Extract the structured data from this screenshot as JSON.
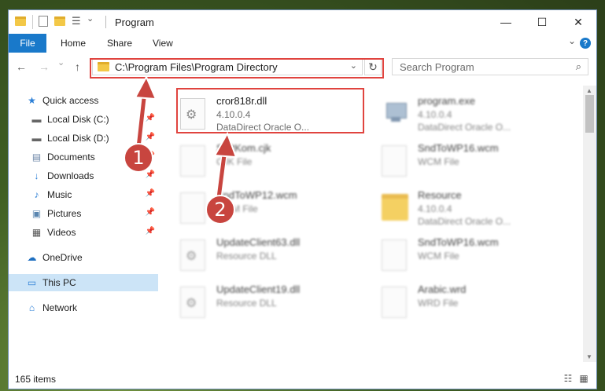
{
  "window": {
    "title": "Program"
  },
  "titlebar": {
    "minimize": "—",
    "maximize": "☐",
    "close": "✕"
  },
  "ribbon": {
    "file": "File",
    "tabs": [
      "Home",
      "Share",
      "View"
    ],
    "collapse": "⌄",
    "help": "?"
  },
  "nav": {
    "back": "←",
    "forward": "→",
    "dropdown": "⌄",
    "up": "↑"
  },
  "address": {
    "path": "C:\\Program Files\\Program Directory",
    "dropdown": "⌄",
    "refresh": "↻"
  },
  "search": {
    "placeholder": "Search Program",
    "icon": "⌕"
  },
  "sidebar": {
    "items": [
      {
        "label": "Quick access",
        "icon": "★"
      },
      {
        "label": "Local Disk (C:)",
        "icon": "▬"
      },
      {
        "label": "Local Disk (D:)",
        "icon": "▬"
      },
      {
        "label": "Documents",
        "icon": "▤"
      },
      {
        "label": "Downloads",
        "icon": "↓"
      },
      {
        "label": "Music",
        "icon": "♪"
      },
      {
        "label": "Pictures",
        "icon": "▣"
      },
      {
        "label": "Videos",
        "icon": "▦"
      },
      {
        "label": "OneDrive",
        "icon": "☁"
      },
      {
        "label": "This PC",
        "icon": "▭"
      },
      {
        "label": "Network",
        "icon": "⌂"
      }
    ],
    "pin": "📌"
  },
  "files": [
    {
      "name": "cror818r.dll",
      "line1": "4.10.0.4",
      "line2": "DataDirect Oracle O..."
    },
    {
      "name": "program.exe",
      "line1": "4.10.0.4",
      "line2": "DataDirect Oracle O..."
    },
    {
      "name": "SoftKom.cjk",
      "line1": "CJK File",
      "line2": ""
    },
    {
      "name": "SndToWP16.wcm",
      "line1": "WCM File",
      "line2": ""
    },
    {
      "name": "SndToWP12.wcm",
      "line1": "WCM File",
      "line2": ""
    },
    {
      "name": "Resource",
      "line1": "4.10.0.4",
      "line2": "DataDirect Oracle O..."
    },
    {
      "name": "UpdateClient63.dll",
      "line1": "Resource DLL",
      "line2": ""
    },
    {
      "name": "SndToWP16.wcm",
      "line1": "WCM File",
      "line2": ""
    },
    {
      "name": "UpdateClient19.dll",
      "line1": "Resource DLL",
      "line2": ""
    },
    {
      "name": "Arabic.wrd",
      "line1": "WRD File",
      "line2": ""
    }
  ],
  "gear": "⚙",
  "status": {
    "count": "165 items"
  },
  "view_icons": {
    "details": "☷",
    "tiles": "▦"
  },
  "callouts": [
    "1",
    "2"
  ],
  "colors": {
    "accent": "#1979ca",
    "highlight": "#e0443f",
    "callout": "#c8453f"
  }
}
